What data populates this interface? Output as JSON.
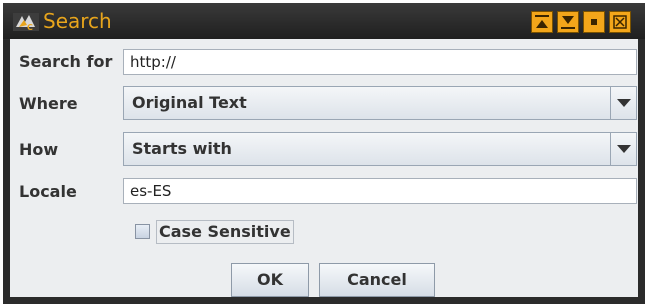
{
  "window": {
    "title": "Search",
    "controls": [
      "minimize-icon",
      "maximize-icon",
      "restore-icon",
      "close-icon"
    ],
    "accent_color": "#f3a61a"
  },
  "form": {
    "search_for": {
      "label": "Search for",
      "value": "http://"
    },
    "where": {
      "label": "Where",
      "selected": "Original Text"
    },
    "how": {
      "label": "How",
      "selected": "Starts with"
    },
    "locale": {
      "label": "Locale",
      "value": "es-ES"
    },
    "case_sensitive": {
      "label": "Case Sensitive",
      "checked": false
    }
  },
  "buttons": {
    "ok": "OK",
    "cancel": "Cancel"
  }
}
